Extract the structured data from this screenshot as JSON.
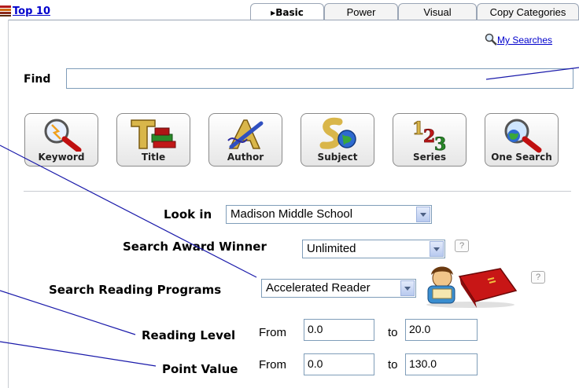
{
  "header": {
    "top10_label": "Top 10",
    "tabs": [
      {
        "label": "Basic",
        "active": true
      },
      {
        "label": "Power",
        "active": false
      },
      {
        "label": "Visual",
        "active": false
      },
      {
        "label": "Copy Categories",
        "active": false
      }
    ],
    "active_marker": "▸"
  },
  "my_searches_label": "My Searches",
  "find": {
    "label": "Find",
    "value": ""
  },
  "search_buttons": [
    {
      "label": "Keyword",
      "icon": "keyword-magnifier-icon"
    },
    {
      "label": "Title",
      "icon": "title-books-icon"
    },
    {
      "label": "Author",
      "icon": "author-pen-icon"
    },
    {
      "label": "Subject",
      "icon": "subject-globe-icon"
    },
    {
      "label": "Series",
      "icon": "series-numbers-icon"
    },
    {
      "label": "One Search",
      "icon": "one-search-globe-icon"
    }
  ],
  "form": {
    "look_in": {
      "label": "Look in",
      "value": "Madison Middle School"
    },
    "award": {
      "label": "Search Award Winner",
      "value": "Unlimited",
      "help": "?"
    },
    "reading_programs": {
      "label": "Search Reading Programs",
      "value": "Accelerated Reader",
      "help": "?"
    },
    "reading_level": {
      "label": "Reading Level",
      "from_label": "From",
      "from": "0.0",
      "to_label": "to",
      "to": "20.0"
    },
    "point_value": {
      "label": "Point Value",
      "from_label": "From",
      "from": "0.0",
      "to_label": "to",
      "to": "130.0"
    }
  },
  "colors": {
    "link": "#0000cc",
    "callout_line": "#0000aa",
    "book_red": "#cc1111"
  }
}
